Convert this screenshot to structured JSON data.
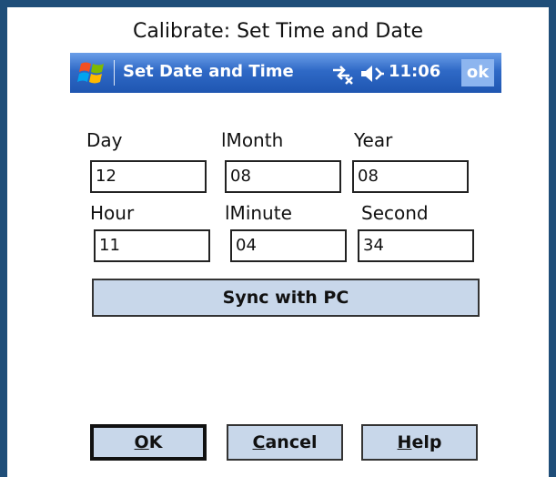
{
  "caption": "Calibrate: Set Time and Date",
  "titlebar": {
    "title": "Set Date and Time",
    "time": "11:06",
    "ok_label": "ok",
    "icons": [
      "windows-logo",
      "connectivity-icon",
      "speaker-icon"
    ]
  },
  "fields": {
    "day": {
      "label": "Day",
      "value": "12"
    },
    "month": {
      "label": "lMonth",
      "value": "08"
    },
    "year": {
      "label": "Year",
      "value": "08"
    },
    "hour": {
      "label": "Hour",
      "value": "11"
    },
    "minute": {
      "label": "lMinute",
      "value": "04"
    },
    "second": {
      "label": "Second",
      "value": "34"
    }
  },
  "sync_label": "Sync with PC",
  "buttons": {
    "ok": {
      "first": "O",
      "rest": "K"
    },
    "cancel": {
      "first": "C",
      "rest": "ancel"
    },
    "help": {
      "first": "H",
      "rest": "elp"
    }
  },
  "colors": {
    "frame": "#1f4e79",
    "titlebar": "#2f69c6",
    "button": "#c8d7ea"
  }
}
